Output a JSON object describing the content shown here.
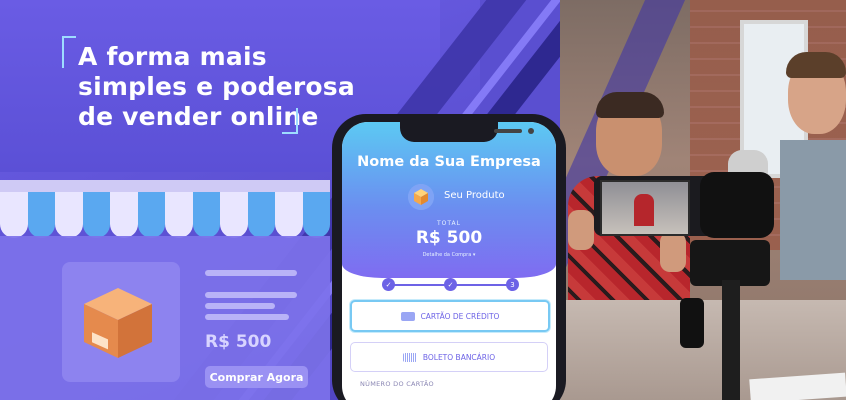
{
  "banner": {
    "headline": [
      "A forma mais",
      "simples e poderosa",
      "de vender online"
    ]
  },
  "store": {
    "price": "R$ 500",
    "buy_button": "Comprar Agora"
  },
  "phone": {
    "company_name": "Nome da Sua Empresa",
    "product_name": "Seu Produto",
    "total_label": "TOTAL",
    "total_value": "R$ 500",
    "details_link": "Detalhe da Compra ▾",
    "steps": [
      "✓",
      "✓",
      "3"
    ],
    "payment_options": [
      {
        "label": "CARTÃO DE CRÉDITO",
        "icon": "credit-card-icon",
        "selected": true
      },
      {
        "label": "BOLETO BANCÁRIO",
        "icon": "barcode-icon",
        "selected": false
      }
    ],
    "card_number_label": "NÚMERO DO CARTÃO"
  },
  "colors": {
    "brand_purple": "#5a4fd0",
    "accent_blue": "#5aa8f0",
    "phone_gradient_top": "#5cc9f3",
    "phone_gradient_bottom": "#7f6cf1"
  }
}
